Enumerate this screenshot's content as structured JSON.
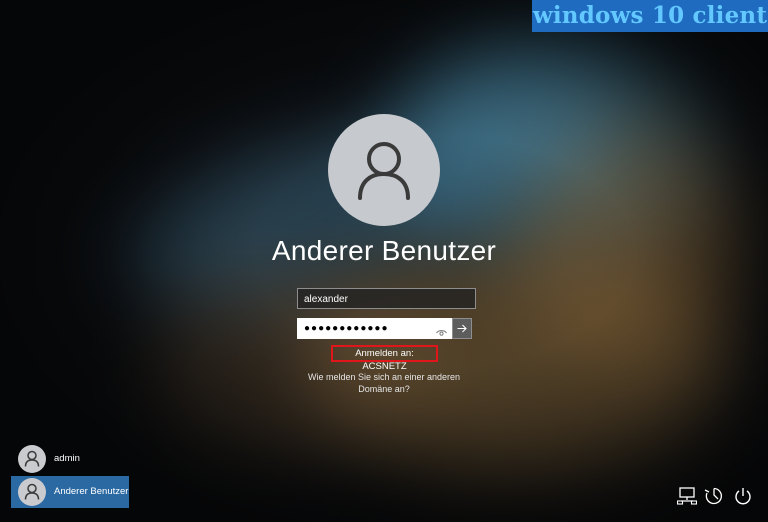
{
  "watermark": "windows 10 client",
  "login": {
    "user_title": "Anderer Benutzer",
    "username_value": "alexander",
    "password_mask": "●●●●●●●●●●●●",
    "signin_to": "Anmelden an: ACSNETZ",
    "other_domain_line1": "Wie melden Sie sich an einer anderen",
    "other_domain_line2": "Domäne an?"
  },
  "accounts": [
    {
      "name": "admin",
      "selected": false
    },
    {
      "name": "Anderer Benutzer",
      "selected": true
    }
  ],
  "tray": {
    "icons": [
      "network-icon",
      "ease-of-access-icon",
      "power-icon"
    ]
  },
  "colors": {
    "selected_account_bg": "#2b69a3",
    "highlight_border": "#e0161a",
    "watermark_bg": "#1e6bbf",
    "watermark_text": "#62c8ff"
  }
}
